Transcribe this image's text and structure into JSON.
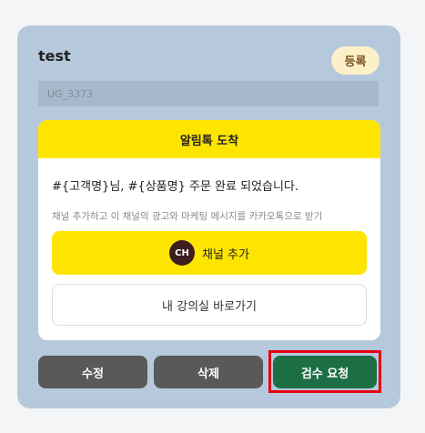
{
  "card": {
    "title": "test",
    "badge": "등록",
    "code": "UG_3373"
  },
  "message": {
    "header": "알림톡 도착",
    "body": "#{고객명}님, #{상품명} 주문 완료 되었습니다.",
    "sub": "채널 추가하고 이 채널의 광고와 마케팅 메시지를 카카오톡으로 받기",
    "channel_icon": "CH",
    "channel_button": "채널 추가",
    "link_button": "내 강의실 바로가기"
  },
  "actions": {
    "edit": "수정",
    "delete": "삭제",
    "review": "검수 요청"
  },
  "colors": {
    "card_bg": "#b6c9dc",
    "kakao_yellow": "#fee500",
    "review_green": "#1e6e45",
    "highlight_red": "#e60012"
  }
}
